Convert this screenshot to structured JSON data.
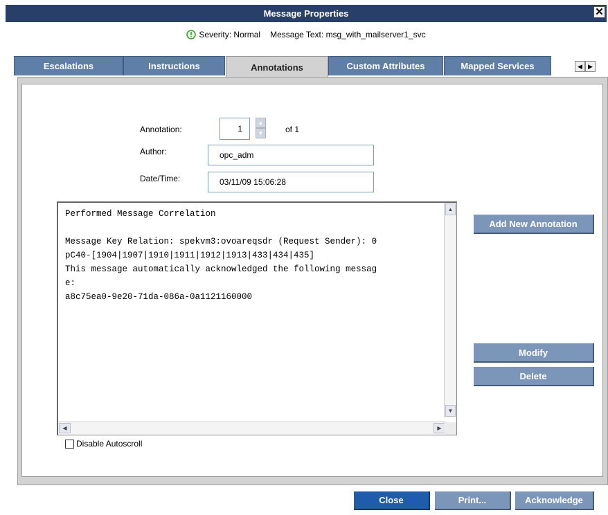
{
  "window": {
    "title": "Message Properties",
    "close_label": "✕"
  },
  "info": {
    "severity_label": "Severity: Normal",
    "message_text_label": "Message Text: msg_with_mailserver1_svc"
  },
  "tabs": [
    {
      "label": "Escalations",
      "active": false
    },
    {
      "label": "Instructions",
      "active": false
    },
    {
      "label": "Annotations",
      "active": true
    },
    {
      "label": "Custom Attributes",
      "active": false
    },
    {
      "label": "Mapped Services",
      "active": false
    }
  ],
  "annotation": {
    "annotation_label": "Annotation:",
    "index_value": "1",
    "of_label": "of 1",
    "author_label": "Author:",
    "author_value": "opc_adm",
    "datetime_label": "Date/Time:",
    "datetime_value": "03/11/09 15:06:28",
    "text_lines": [
      "Performed Message Correlation",
      "",
      "Message Key Relation: spekvm3:ovoareqsdr (Request Sender): 0",
      "pC40-[1904|1907|1910|1911|1912|1913|433|434|435]",
      "This message automatically acknowledged the following messag",
      "e:",
      "a8c75ea0-9e20-71da-086a-0a1121160000"
    ],
    "disable_autoscroll_label": "Disable Autoscroll",
    "disable_autoscroll_checked": false
  },
  "side_buttons": {
    "add_new": "Add New Annotation",
    "modify": "Modify",
    "delete": "Delete"
  },
  "footer": {
    "close": "Close",
    "print": "Print...",
    "acknowledge": "Acknowledge"
  },
  "colors": {
    "titlebar": "#283f67",
    "tab": "#5f7fa8",
    "primary_button": "#1f5cab",
    "secondary_button": "#7b96b8",
    "severity_icon": "#3c9a2c"
  },
  "icons": {
    "severity": "info-circle-icon",
    "close": "close-icon",
    "spinner_up": "chevron-up-icon",
    "spinner_down": "chevron-down-icon",
    "tab_scroll_left": "arrow-left-icon",
    "tab_scroll_right": "arrow-right-icon"
  }
}
